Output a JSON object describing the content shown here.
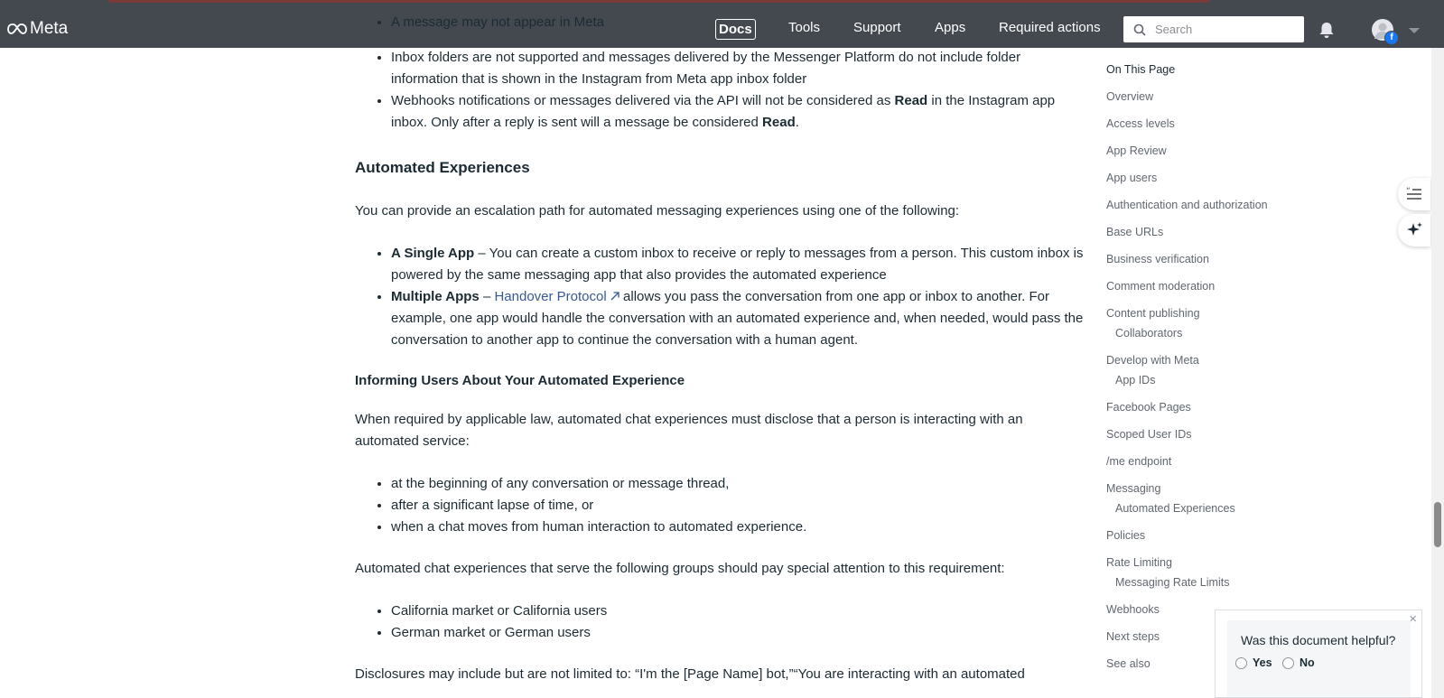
{
  "nav": {
    "brand": "Meta",
    "items": [
      "Docs",
      "Tools",
      "Support",
      "Apps",
      "Required actions"
    ],
    "search_placeholder": "Search"
  },
  "content": {
    "clipped_line_1": "A message may not appear in Meta",
    "clipped_line_2": "Inbox folders are not supported and messages delivered by the Messenger Platform do not include folder",
    "folder_line_end": "information that is shown in the Instagram from Meta app inbox folder",
    "webhooks_bullet": {
      "part1": "Webhooks notifications or messages delivered via the API will not be considered as ",
      "bold1": "Read",
      "part2": " in the Instagram app inbox. Only after a reply is sent will a message be considered ",
      "bold2": "Read",
      "part3": "."
    },
    "automated_heading": "Automated Experiences",
    "automated_intro": "You can provide an escalation path for automated messaging experiences using one of the following:",
    "single_app": {
      "label": "A Single App",
      "text": " – You can create a custom inbox to receive or reply to messages from a person. This custom inbox is powered by the same messaging app that also provides the automated experience"
    },
    "multiple_apps": {
      "label": "Multiple Apps",
      "dash": " – ",
      "link": "Handover Protocol",
      "text": " allows you pass the conversation from one app or inbox to another. For example, one app would handle the conversation with an automated experience and, when needed, would pass the conversation to another app to continue the conversation with a human agent."
    },
    "informing_heading": "Informing Users About Your Automated Experience",
    "informing_intro": "When required by applicable law, automated chat experiences must disclose that a person is interacting with an automated service:",
    "informing_items": [
      "at the beginning of any conversation or message thread,",
      "after a significant lapse of time, or",
      "when a chat moves from human interaction to automated experience."
    ],
    "groups_intro": "Automated chat experiences that serve the following groups should pay special attention to this requirement:",
    "groups_items": [
      "California market or California users",
      "German market or German users"
    ],
    "disclosures": "Disclosures may include but are not limited to: “I'm the [Page Name] bot,”“You are interacting with an automated"
  },
  "toc": {
    "heading": "On This Page",
    "items": [
      {
        "label": "Overview",
        "sub": false
      },
      {
        "label": "Access levels",
        "sub": false
      },
      {
        "label": "App Review",
        "sub": false
      },
      {
        "label": "App users",
        "sub": false
      },
      {
        "label": "Authentication and authorization",
        "sub": false
      },
      {
        "label": "Base URLs",
        "sub": false
      },
      {
        "label": "Business verification",
        "sub": false
      },
      {
        "label": "Comment moderation",
        "sub": false
      },
      {
        "label": "Content publishing",
        "sub": false
      },
      {
        "label": "Collaborators",
        "sub": true
      },
      {
        "label": "Develop with Meta",
        "sub": false
      },
      {
        "label": "App IDs",
        "sub": true
      },
      {
        "label": "Facebook Pages",
        "sub": false
      },
      {
        "label": "Scoped User IDs",
        "sub": false
      },
      {
        "label": "/me endpoint",
        "sub": false
      },
      {
        "label": "Messaging",
        "sub": false
      },
      {
        "label": "Automated Experiences",
        "sub": true
      },
      {
        "label": "Policies",
        "sub": false
      },
      {
        "label": "Rate Limiting",
        "sub": false
      },
      {
        "label": "Messaging Rate Limits",
        "sub": true
      },
      {
        "label": "Webhooks",
        "sub": false
      },
      {
        "label": "Next steps",
        "sub": false
      },
      {
        "label": "See also",
        "sub": false
      }
    ]
  },
  "feedback": {
    "question": "Was this document helpful?",
    "yes": "Yes",
    "no": "No",
    "close": "×"
  }
}
